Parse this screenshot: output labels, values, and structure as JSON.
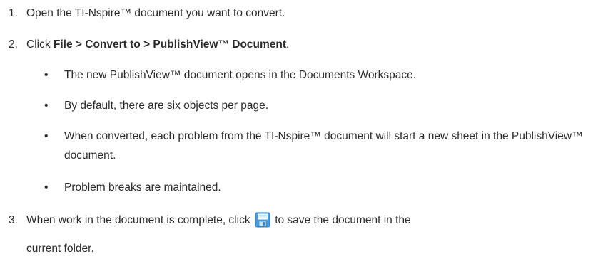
{
  "steps": [
    {
      "number": "1.",
      "text": "Open the TI-Nspire™ document you want to convert."
    },
    {
      "number": "2.",
      "prefix": "Click ",
      "menu_path": "File > Convert to > PublishView™ Document",
      "suffix": ".",
      "bullets": [
        "The new PublishView™ document opens in the Documents Workspace.",
        "By default, there are six objects per page.",
        "When converted, each problem from the TI-Nspire™ document will start a new sheet in the PublishView™ document.",
        "Problem breaks are maintained."
      ]
    },
    {
      "number": "3.",
      "prefix": "When work in the document is complete, click ",
      "icon": "save-icon",
      "suffix": " to save the document in the",
      "continuation": "current folder."
    }
  ],
  "bullet_char": "•",
  "colors": {
    "text": "#2b2b2b",
    "icon_blue": "#4a9bd8",
    "icon_light": "#bfe3f7"
  }
}
